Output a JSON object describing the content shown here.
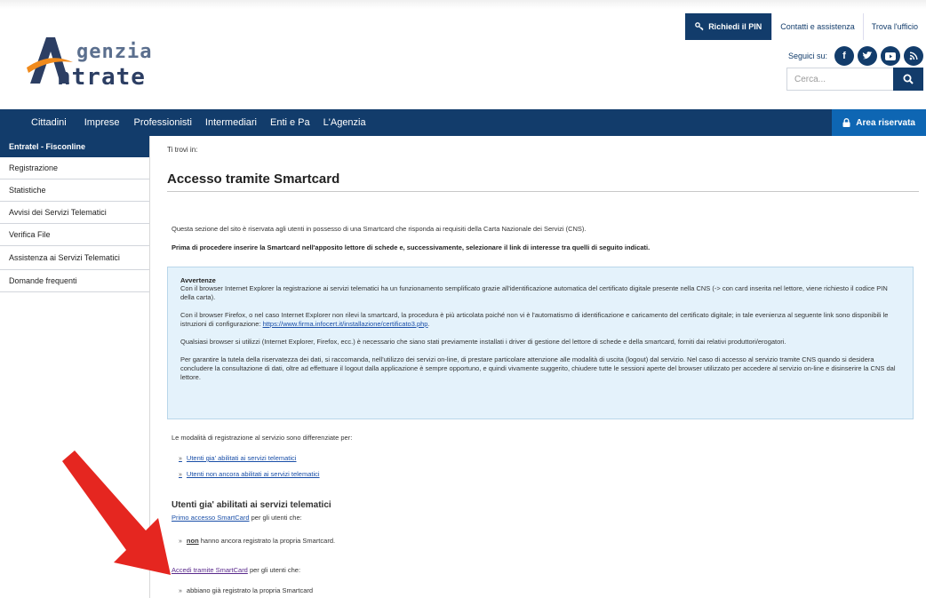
{
  "header": {
    "logo_line1": "genzia",
    "logo_line2": "ntrate",
    "pin_button": "Richiedi il PIN",
    "contacts_link": "Contatti e assistenza",
    "office_link": "Trova l'ufficio",
    "follow_label": "Seguici su:",
    "social_icons": [
      "facebook-icon",
      "twitter-icon",
      "youtube-icon",
      "rss-icon"
    ],
    "search_placeholder": "Cerca..."
  },
  "nav": {
    "items": [
      "Cittadini",
      "Imprese",
      "Professionisti",
      "Intermediari",
      "Enti e Pa",
      "L'Agenzia"
    ],
    "reserved_area": "Area riservata"
  },
  "sidebar": {
    "header": "Entratel - Fisconline",
    "items": [
      "Registrazione",
      "Statistiche",
      "Avvisi dei Servizi Telematici",
      "Verifica File",
      "Assistenza ai Servizi Telematici",
      "Domande frequenti"
    ]
  },
  "content": {
    "breadcrumb": "Ti trovi in:",
    "title": "Accesso tramite Smartcard",
    "intro": "Questa sezione del sito è riservata agli utenti in possesso di una Smartcard che risponda ai requisiti della Carta Nazionale dei Servizi (CNS).",
    "intro_bold": "Prima di procedere inserire la Smartcard nell'apposito lettore di schede e, successivamente, selezionare il link di interesse tra quelli di seguito indicati.",
    "warning": {
      "title": "Avvertenze",
      "p1": "Con il browser Internet Explorer la registrazione ai servizi telematici ha un funzionamento semplificato grazie all'identificazione automatica del certificato digitale presente nella CNS (-> con card inserita nel lettore, viene richiesto il codice PIN della carta).",
      "p2": "Con il browser Firefox, o nel caso Internet Explorer non rilevi la smartcard, la procedura è più articolata poiché non vi è l'automatismo di identificazione e caricamento del certificato digitale; in tale evenienza al seguente link sono disponibili le istruzioni di configurazione:",
      "p2_link": "https://www.firma.infocert.it/installazione/certificato3.php",
      "p3": "Qualsiasi browser si utilizzi (Internet Explorer, Firefox, ecc.) è necessario che siano stati previamente installati i driver di gestione del lettore di schede e della smartcard, forniti dai relativi produttori/erogatori.",
      "p4": "Per garantire la tutela della riservatezza dei dati, si raccomanda, nell'utilizzo dei servizi on-line, di prestare particolare attenzione alle modalità di uscita (logout) dal servizio. Nel caso di accesso al servizio tramite CNS quando si desidera concludere la consultazione di dati, oltre ad effettuare il logout dalla applicazione è sempre opportuno, e quindi vivamente suggerito, chiudere tutte le sessioni aperte del browser utilizzato per accedere al servizio on-line e disinserire la CNS dal lettore."
    },
    "modalities": "Le modalità di registrazione al servizio sono differenziate per:",
    "links": [
      "Utenti gia' abilitati ai servizi telematici",
      "Utenti non ancora abilitati ai servizi telematici"
    ],
    "subtitle": "Utenti gia' abilitati ai servizi telematici",
    "first_access_link": "Primo accesso SmartCard",
    "first_access_suffix": " per gli utenti che:",
    "first_access_bullet_bold": "non",
    "first_access_bullet_rest": " hanno ancora registrato la propria Smartcard.",
    "access_link": "Accedi tramite SmartCard",
    "access_suffix": " per gli utenti che:",
    "access_bullet": "abbiano già registrato la propria Smartcard"
  },
  "colors": {
    "primary": "#123c6b",
    "accent_blue": "#0e66b3",
    "warning_bg": "#e4f2fb",
    "arrow_red": "#e52620",
    "logo_orange": "#f08a1c"
  }
}
